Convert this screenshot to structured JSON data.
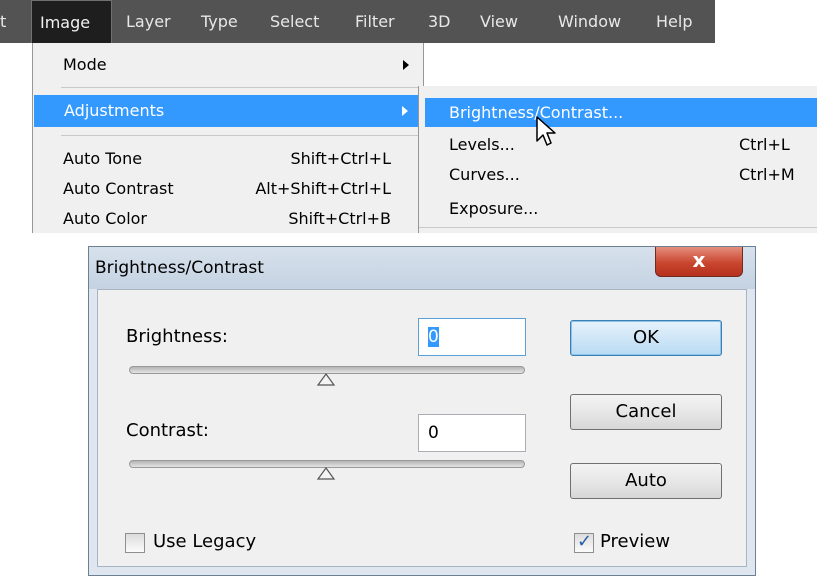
{
  "menubar": {
    "items": [
      {
        "label": "t"
      },
      {
        "label": "Image"
      },
      {
        "label": "Layer"
      },
      {
        "label": "Type"
      },
      {
        "label": "Select"
      },
      {
        "label": "Filter"
      },
      {
        "label": "3D"
      },
      {
        "label": "View"
      },
      {
        "label": "Window"
      },
      {
        "label": "Help"
      }
    ]
  },
  "image_menu": {
    "items": [
      {
        "label": "Mode",
        "shortcut": ""
      },
      {
        "label": "Adjustments",
        "shortcut": ""
      },
      {
        "label": "Auto Tone",
        "shortcut": "Shift+Ctrl+L"
      },
      {
        "label": "Auto Contrast",
        "shortcut": "Alt+Shift+Ctrl+L"
      },
      {
        "label": "Auto Color",
        "shortcut": "Shift+Ctrl+B"
      }
    ]
  },
  "adjustments_submenu": {
    "items": [
      {
        "label": "Brightness/Contrast...",
        "shortcut": ""
      },
      {
        "label": "Levels...",
        "shortcut": "Ctrl+L"
      },
      {
        "label": "Curves...",
        "shortcut": "Ctrl+M"
      },
      {
        "label": "Exposure...",
        "shortcut": ""
      }
    ]
  },
  "dialog": {
    "title": "Brightness/Contrast",
    "close_glyph": "x",
    "brightness_label": "Brightness:",
    "brightness_value": "0",
    "contrast_label": "Contrast:",
    "contrast_value": "0",
    "ok_label": "OK",
    "cancel_label": "Cancel",
    "auto_label": "Auto",
    "use_legacy_label": "Use Legacy",
    "use_legacy_checked": false,
    "preview_label": "Preview",
    "preview_checked": true,
    "brightness_slider_fraction": 0.5,
    "contrast_slider_fraction": 0.5
  },
  "colors": {
    "menubar_bg": "#535353",
    "highlight": "#3399ff",
    "close_button": "#c9462f"
  },
  "icons": [
    "submenu-arrow-icon",
    "mouse-cursor-icon",
    "close-icon",
    "checkmark-icon",
    "slider-thumb-icon"
  ]
}
